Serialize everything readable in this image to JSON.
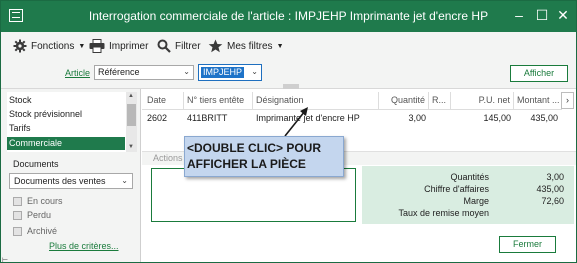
{
  "window": {
    "title": "Interrogation commerciale de l'article : IMPJEHP Imprimante jet d'encre HP",
    "icon": "app-window-icon",
    "controls": {
      "minimize": "–",
      "maximize": "☐",
      "close": "✕"
    }
  },
  "toolbar": {
    "fonctions_label": "Fonctions",
    "imprimer_label": "Imprimer",
    "filtrer_label": "Filtrer",
    "mesfiltres_label": "Mes filtres"
  },
  "filter": {
    "article_link": "Article",
    "criteria_value": "Référence",
    "code_value": "IMPJEHP",
    "afficher_label": "Afficher"
  },
  "sidebar": {
    "items": [
      {
        "label": "Stock"
      },
      {
        "label": "Stock prévisionnel"
      },
      {
        "label": "Tarifs"
      },
      {
        "label": "Commerciale"
      }
    ],
    "selected_index": 3,
    "documents_label": "Documents",
    "documents_type": "Documents des ventes",
    "checks": [
      {
        "label": "En cours"
      },
      {
        "label": "Perdu"
      },
      {
        "label": "Archivé"
      }
    ],
    "more_criteria": "Plus de critères..."
  },
  "table": {
    "columns": [
      "Date",
      "N° tiers entête",
      "Désignation",
      "Quantité",
      "R...",
      "P.U. net",
      "Montant ..."
    ],
    "rows": [
      {
        "date": "2602",
        "tiers": "411BRITT",
        "designation": "Imprimante jet d'encre HP",
        "quantite": "3,00",
        "r": "",
        "pu": "145,00",
        "montant": "435,00"
      }
    ],
    "scroll_arrow": "›"
  },
  "actions": {
    "label": "Actions"
  },
  "summary": {
    "rows": [
      {
        "label": "Quantités",
        "value": "3,00"
      },
      {
        "label": "Chiffre d'affaires",
        "value": "435,00"
      },
      {
        "label": "Marge",
        "value": "72,60"
      },
      {
        "label": "Taux de remise moyen",
        "value": ""
      }
    ]
  },
  "footer": {
    "fermer_label": "Fermer"
  },
  "callout": {
    "line1": "<DOUBLE CLIC> POUR",
    "line2": "AFFICHER LA PIÈCE"
  },
  "colors": {
    "brand_green": "#1f7a4c",
    "link_green": "#1a7b3c",
    "summary_bg": "#d9ede1",
    "selection_blue": "#1e73c8",
    "callout_bg": "#c4d6ee"
  }
}
